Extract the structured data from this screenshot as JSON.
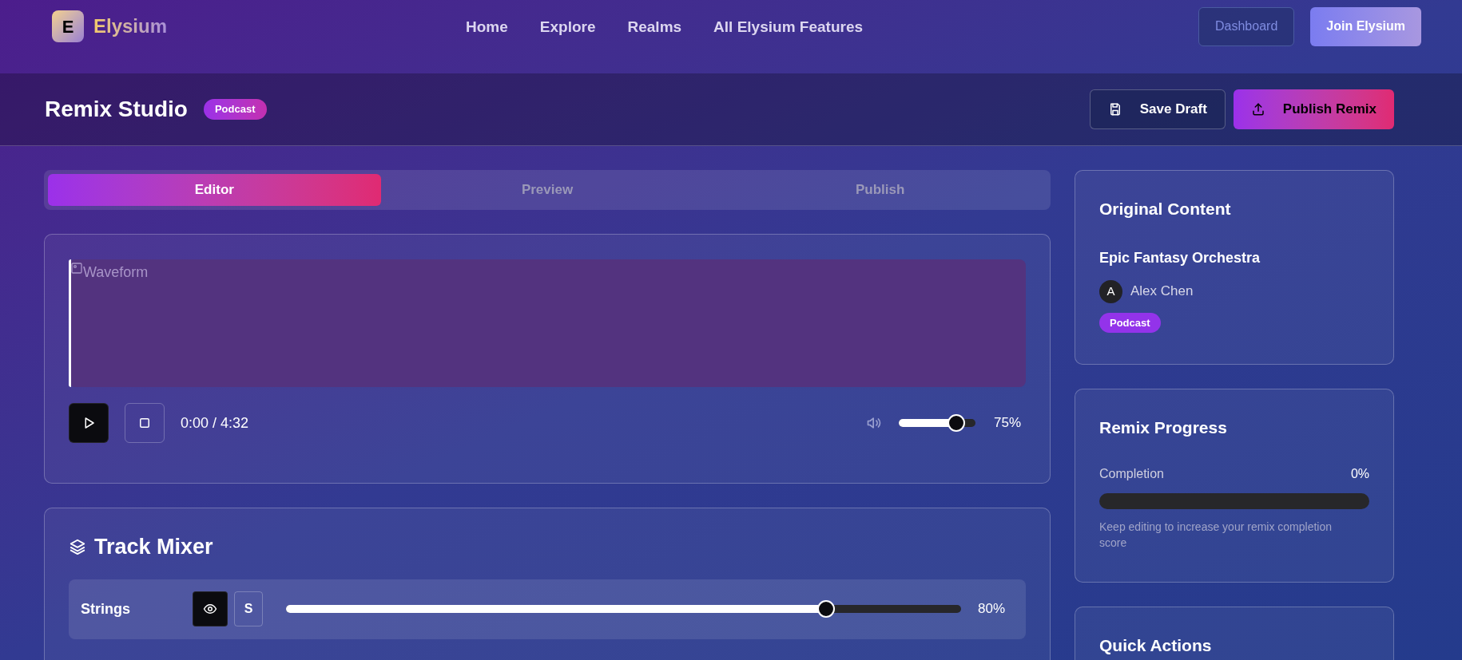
{
  "brand": {
    "letter": "E",
    "name": "Elysium"
  },
  "nav": [
    "Home",
    "Explore",
    "Realms",
    "All Elysium Features"
  ],
  "header_buttons": [
    {
      "label": "Dashboard",
      "kind": "outline"
    },
    {
      "label": "Join Elysium",
      "kind": "primary"
    }
  ],
  "page": {
    "title": "Remix Studio",
    "badge": "Podcast",
    "actions": [
      {
        "label": "Save Draft",
        "kind": "outline"
      },
      {
        "label": "Publish Remix",
        "kind": "primary"
      }
    ]
  },
  "tabs": [
    {
      "label": "Editor",
      "selected": true
    },
    {
      "label": "Preview",
      "selected": false
    },
    {
      "label": "Publish",
      "selected": false
    }
  ],
  "player": {
    "waveform_alt": "Waveform",
    "playing": false,
    "time": "0:00 / 4:32",
    "volume": {
      "level": 0.75,
      "reading": "75%"
    }
  },
  "mixer": {
    "title": "Track Mixer",
    "tracks": [
      {
        "name": "Strings",
        "visible": true,
        "solo_label": "S",
        "solo": false,
        "level": 0.8,
        "reading": "80%"
      }
    ]
  },
  "original": {
    "title": "Original Content",
    "content_title": "Epic Fantasy Orchestra",
    "author": {
      "initial": "A",
      "name": "Alex Chen"
    },
    "tag": "Podcast"
  },
  "progress": {
    "title": "Remix Progress",
    "label": "Completion",
    "reading": "0%",
    "level": 0,
    "hint": "Keep editing to increase your remix completion score"
  },
  "quick_actions": {
    "title": "Quick Actions"
  }
}
